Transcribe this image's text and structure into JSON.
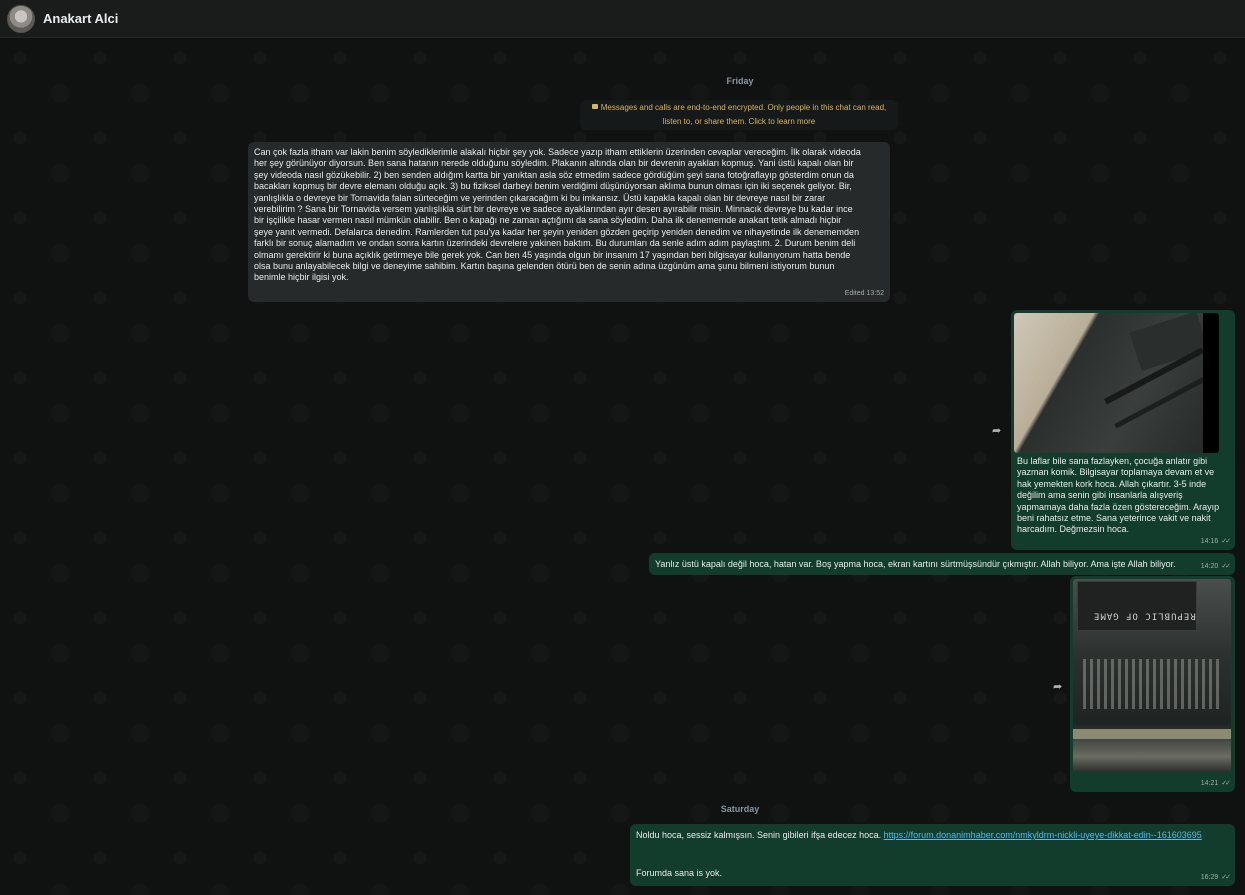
{
  "header": {
    "contact_name": "Anakart Alci"
  },
  "chat": {
    "date_friday": "Friday",
    "encryption_notice_line1": "Messages and calls are end-to-end encrypted. Only people in this chat can read,",
    "encryption_notice_line2": "listen to, or share them. Click to learn more",
    "msg1": {
      "lines": [
        "Can çok fazla itham var lakin benim söylediklerimle alakalı hiçbir şey yok. Sadece yazıp itham ettiklerin üzerinden cevaplar vereceğim. İlk olarak videoda",
        "her şey görünüyor diyorsun. Ben sana hatanın nerede olduğunu söyledim. Plakanın altında olan bir devrenin ayakları kopmuş. Yani üstü kapalı olan bir",
        "şey videoda nasıl gözükebilir. 2) ben senden aldığım kartta bir yanıktan asla söz etmedim sadece gördüğüm şeyi sana fotoğraflayıp gösterdim onun da",
        "bacakları kopmuş bir devre elemanı olduğu açık. 3) bu fiziksel darbeyi benim verdiğimi düşünüyorsan aklıma bunun olması için iki seçenek geliyor. Bir,",
        "yanlışlıkla o devreye bir Tornavida falan sürteceğim ve yerinden çıkaracağım ki bu imkansız. Üstü kapakla kapalı olan  bir devreye nasıl bir zarar",
        "verebilirim ? Sana bir Tornavida versem yanlışlıkla sürt bir devreye ve sadece ayaklarından ayır desen ayırabilir misin. Minnacık devreye  bu kadar ince",
        "bir işçilikle hasar vermen nasıl mümkün olabilir.  Ben o kapağı ne zaman açtığımı da sana söyledim. Daha ilk denememde anakart tetik almadı hiçbir",
        "şeye yanıt vermedi. Defalarca denedim. Ramlerden tut psu'ya kadar her şeyin yeniden gözden geçirip yeniden denedim ve nihayetinde ilk denememden",
        "farklı bir sonuç alamadım ve ondan sonra kartın üzerindeki devrelere yakinen baktım. Bu durumları da senle adım adım paylaştım. 2. Durum benim deli",
        "olmamı gerektirir ki buna açıklık getirmeye bile gerek yok. Can ben 45 yaşında olgun bir insanım 17 yaşından beri bilgisayar kullanıyorum hatta bende",
        "olsa bunu anlayabilecek bilgi ve deneyime sahibim. Kartın başına gelenden ötürü ben de senin adına üzgünüm ama şunu bilmeni istiyorum bunun",
        "benimle hiçbir ilgisi yok."
      ],
      "meta": "Edited 13:52"
    },
    "msg2": {
      "lines": [
        "Bu laflar bile sana fazlayken, çocuğa anlatır gibi",
        "yazman komik. Bilgisayar toplamaya devam et ve",
        "hak yemekten kork hoca. Allah çıkartır. 3-5 inde",
        "değilim ama senin gibi insanlarla alışveriş",
        "yapmamaya daha fazla özen göstereceğim. Arayıp",
        "beni rahatsız etme. Sana yeterince vakit ve nakit",
        "harcadım. Değmezsin hoca."
      ],
      "time": "14:16"
    },
    "msg3": {
      "text": "Yanlız üstü kapalı değil hoca, hatan var. Boş yapma hoca, ekran kartını sürtmüşsündür çıkmıştır. Allah biliyor. Ama işte Allah biliyor.",
      "time": "14:20"
    },
    "msg4": {
      "photo_text": "REPUBLIC OF GAME",
      "time": "14:21"
    },
    "date_saturday": "Saturday",
    "msg5": {
      "text": "Noldu hoca, sessiz kalmışsın. Senin gibileri ifşa edecez hoca.",
      "link": "https://forum.donanimhaber.com/nmkyldrm-nickli-uyeye-dikkat-edin--161603695",
      "text2": "Forumda sana is yok.",
      "time": "16:29"
    }
  }
}
